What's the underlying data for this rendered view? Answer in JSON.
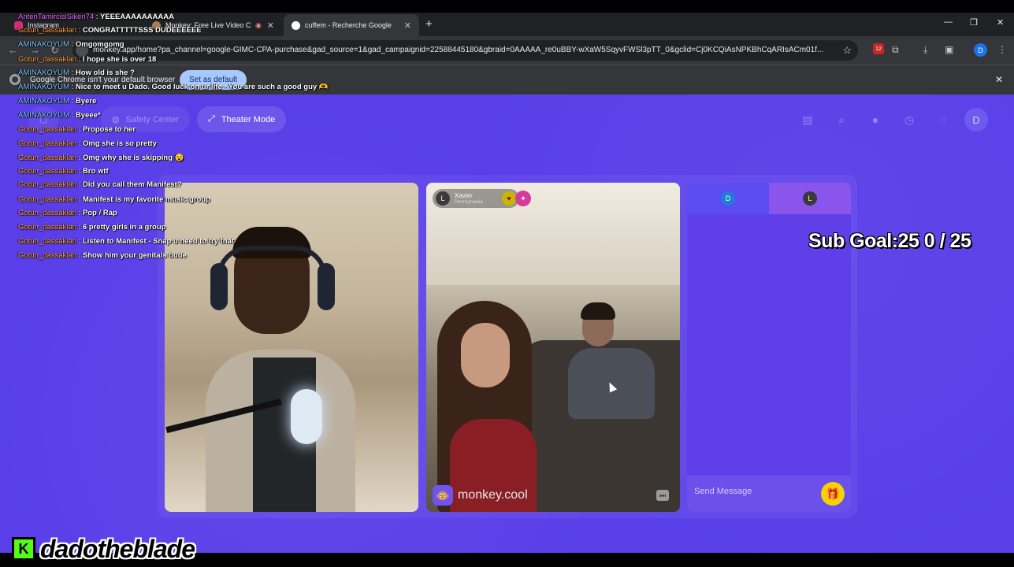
{
  "browser": {
    "tabs": [
      {
        "label": "Instagram"
      },
      {
        "label": "Monkey: Free Live Video Ch"
      },
      {
        "label": "cuffem - Recherche Google"
      }
    ],
    "new_tab": "+",
    "url": "monkey.app/home?pa_channel=google-GIMC-CPA-purchase&gad_source=1&gad_campaignid=22588445180&gbraid=0AAAAA_re0uBBY-wXaW5SqyvFWSl3pTT_0&gclid=Cj0KCQiAsNPKBhCqARIsACm01f...",
    "ext_badge": "12",
    "profile_initial": "D",
    "infobar": {
      "message": "Google Chrome isn't your default browser",
      "button": "Set as default"
    }
  },
  "page": {
    "nav": {
      "theater_mode": "Theater Mode",
      "safety_center": "Safety Center",
      "avatar_initial": "D"
    },
    "left_video": {},
    "right_video": {
      "user_initial": "L",
      "user_name": "Xavier",
      "user_location": "Pennsylvania",
      "brand": "monkey.cool"
    },
    "chat": {
      "tab_a_initial": "D",
      "tab_b_initial": "L",
      "placeholder": "Send Message"
    },
    "sub_goal": "Sub Goal:25  0 / 25"
  },
  "stream_chat": [
    {
      "user": "AntenTamircisiSiken74",
      "text": "YEEEAAAAAAAAAA",
      "color": "#e066ff"
    },
    {
      "user": "Gotun_dassaklari",
      "text": "CONGRATTTTTSSS DUDEEEEEE",
      "color": "#ff9f43"
    },
    {
      "user": "AMINAKOYUM",
      "text": "Omgomgomg",
      "color": "#7fc8ff"
    },
    {
      "user": "Gotun_dassaklari",
      "text": "I hope she is over 18",
      "color": "#ff9f43"
    },
    {
      "user": "AMINAKOYUM",
      "text": "How old is she ?",
      "color": "#7fc8ff"
    },
    {
      "user": "AMINAKOYUM",
      "text": "Nice to meet u Dado. Good luck on ur life - You are such a good guy 🫶",
      "color": "#7fc8ff"
    },
    {
      "user": "AMINAKOYUM",
      "text": "Byere",
      "color": "#7fc8ff"
    },
    {
      "user": "AMINAKOYUM",
      "text": "Byeee*",
      "color": "#7fc8ff"
    },
    {
      "user": "Gotun_dassaklari",
      "text": "Propose to her",
      "color": "#ff9f43"
    },
    {
      "user": "Gotun_dassaklari",
      "text": "Omg she is so pretty",
      "color": "#ff9f43"
    },
    {
      "user": "Gotun_dassaklari",
      "text": "Omg why she is skipping 😵",
      "color": "#ff9f43"
    },
    {
      "user": "Gotun_dassaklari",
      "text": "Bro wtf",
      "color": "#ff9f43"
    },
    {
      "user": "Gotun_dassaklari",
      "text": "Did you call them Manifest?",
      "color": "#ff9f43"
    },
    {
      "user": "Gotun_dassaklari",
      "text": "Manifest is my favorite music group",
      "color": "#ff9f43"
    },
    {
      "user": "Gotun_dassaklari",
      "text": "Pop / Rap",
      "color": "#ff9f43"
    },
    {
      "user": "Gotun_dassaklari",
      "text": "6 pretty girls in a group",
      "color": "#ff9f43"
    },
    {
      "user": "Gotun_dassaklari",
      "text": "Listen to Manifest - Snap u need to try that",
      "color": "#ff9f43"
    },
    {
      "user": "Gotun_dassaklari",
      "text": "Show him your genitals dude",
      "color": "#ff9f43"
    }
  ],
  "streamer": {
    "platform_letter": "K",
    "name": "dadotheblade"
  },
  "colors": {
    "page_bg": "#5a3fe8",
    "kick_green": "#53fc18",
    "gift_yellow": "#f5d300"
  }
}
